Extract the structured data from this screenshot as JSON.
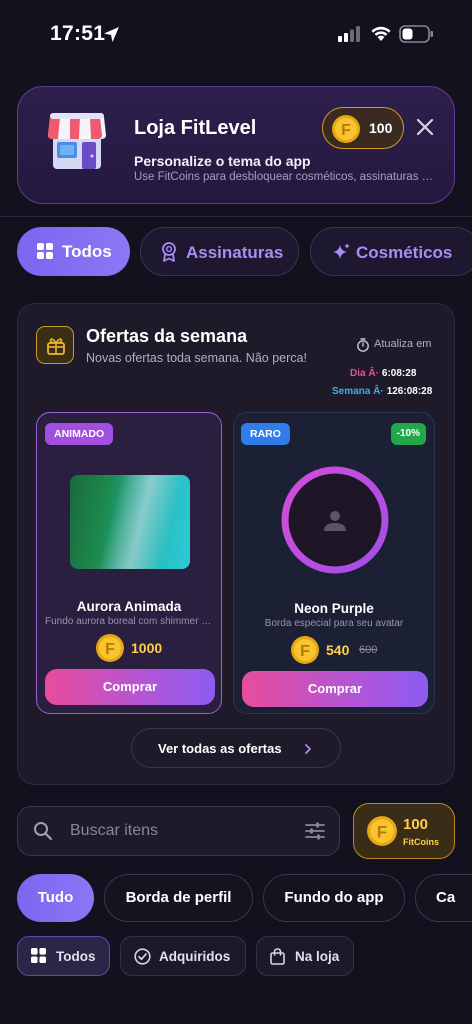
{
  "status_bar": {
    "time": "17:51"
  },
  "store": {
    "title": "Loja FitLevel",
    "subtitle": "Personalize o tema do app",
    "description": "Use FitCoins para desbloquear cosméticos, assinaturas e mais",
    "coin_balance": "100"
  },
  "category_tabs": [
    {
      "label": "Todos",
      "icon": "grid-icon",
      "selected": true
    },
    {
      "label": "Assinaturas",
      "icon": "medal-icon",
      "selected": false
    },
    {
      "label": "Cosméticos",
      "icon": "sparkle-icon",
      "selected": false
    }
  ],
  "weekly_offers": {
    "title": "Ofertas da semana",
    "subtitle": "Novas ofertas toda semana. Não perca!",
    "refresh_label": "Atualiza em",
    "daily_label": "Dia Â·",
    "daily_time": "6:08:28",
    "weekly_label": "Semana Â·",
    "weekly_time": "126:08:28",
    "items": [
      {
        "badge": "ANIMADO",
        "name": "Aurora Animada",
        "description": "Fundo aurora boreal com shimmer animado",
        "price": "1000",
        "buy_label": "Comprar"
      },
      {
        "badge": "RARO",
        "discount": "-10%",
        "name": "Neon Purple",
        "description": "Borda especial para seu avatar",
        "price": "540",
        "old_price": "600",
        "buy_label": "Comprar"
      }
    ],
    "see_all_label": "Ver todas as ofertas"
  },
  "search": {
    "placeholder": "Buscar itens",
    "value": ""
  },
  "balance": {
    "amount": "100",
    "unit": "FitCoins"
  },
  "type_filters": [
    {
      "label": "Tudo",
      "selected": true
    },
    {
      "label": "Borda de perfil",
      "selected": false
    },
    {
      "label": "Fundo do app",
      "selected": false
    },
    {
      "label": "Ca",
      "selected": false
    }
  ],
  "ownership_filters": [
    {
      "label": "Todos",
      "icon": "grid-icon",
      "selected": true
    },
    {
      "label": "Adquiridos",
      "icon": "check-circle-icon",
      "selected": false
    },
    {
      "label": "Na loja",
      "icon": "shopping-bag-icon",
      "selected": false
    }
  ],
  "colors": {
    "background": "#14111f",
    "accent_purple": "#7a66f0",
    "coin_gold": "#ffd04a",
    "buy_gradient_start": "#e84d9b",
    "buy_gradient_end": "#8c5cf0",
    "discount_green": "#22a84a",
    "rare_blue": "#2f7dea",
    "animated_purple": "#a24fe0"
  }
}
